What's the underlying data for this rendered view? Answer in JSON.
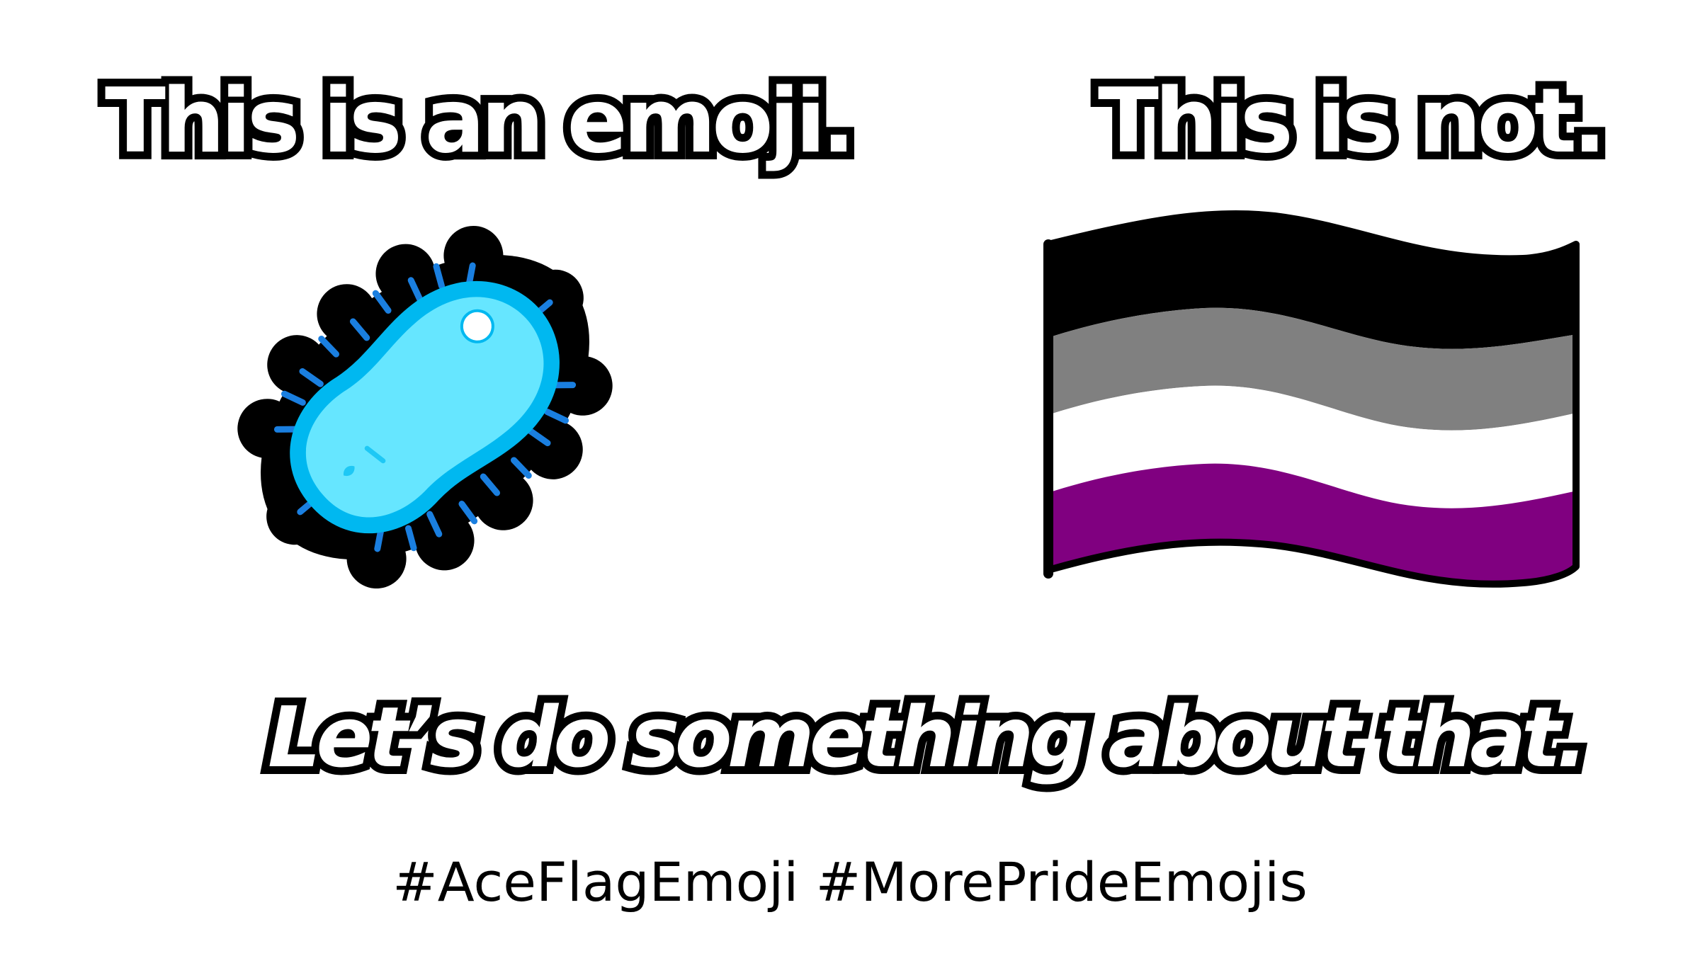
{
  "left_panel": {
    "heading": "This is an emoji.",
    "icon": "microbe-emoji"
  },
  "right_panel": {
    "heading": "This is not.",
    "icon": "asexual-flag",
    "flag_stripe_colors": [
      "#000000",
      "#808080",
      "#ffffff",
      "#800080"
    ]
  },
  "tagline": "Let’s do something about that.",
  "hashtags": "#AceFlagEmoji #MorePrideEmojis",
  "colors": {
    "microbe_body": "#66e6ff",
    "microbe_edge": "#00b8f0",
    "microbe_cilia": "#1a7fe0"
  }
}
